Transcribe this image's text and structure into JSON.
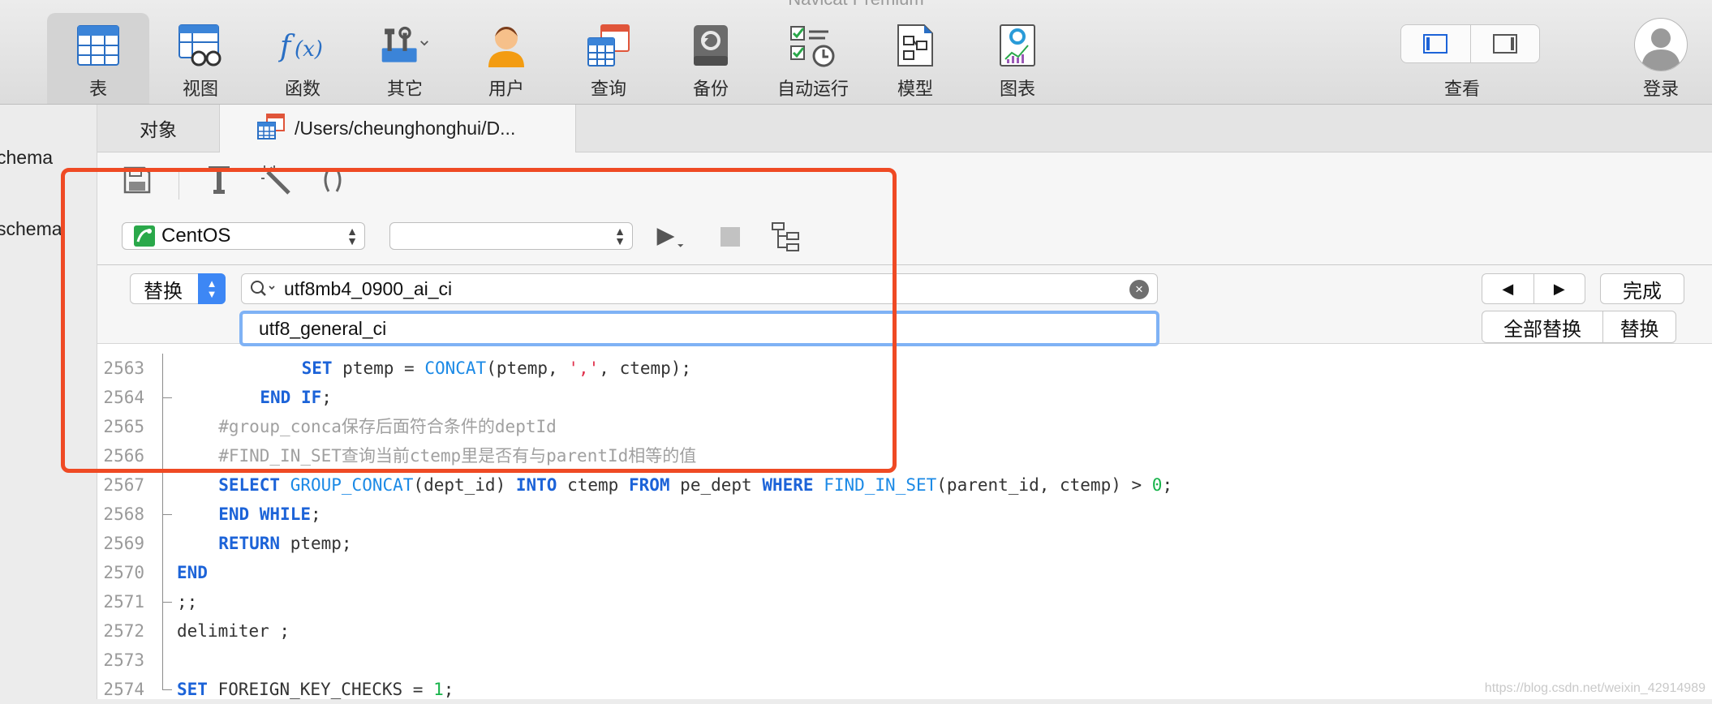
{
  "window_title": "Navicat Premium",
  "toolbar": {
    "items": [
      {
        "label": "表",
        "icon": "table-icon"
      },
      {
        "label": "视图",
        "icon": "view-icon"
      },
      {
        "label": "函数",
        "icon": "function-icon"
      },
      {
        "label": "其它",
        "icon": "tools-icon"
      },
      {
        "label": "用户",
        "icon": "user-icon"
      },
      {
        "label": "查询",
        "icon": "query-icon"
      },
      {
        "label": "备份",
        "icon": "backup-icon"
      },
      {
        "label": "自动运行",
        "icon": "automation-icon"
      },
      {
        "label": "模型",
        "icon": "model-icon"
      },
      {
        "label": "图表",
        "icon": "chart-icon"
      }
    ],
    "view_label": "查看",
    "login_label": "登录"
  },
  "sidebar": {
    "items": [
      "chema",
      "schema"
    ]
  },
  "tabs": {
    "objects": "对象",
    "file": "/Users/cheunghonghui/D..."
  },
  "query": {
    "connection": "CentOS",
    "database": ""
  },
  "find": {
    "mode": "替换",
    "search_value": "utf8mb4_0900_ai_ci",
    "replace_value": "utf8_general_ci",
    "prev_glyph": "◀",
    "next_glyph": "▶",
    "done": "完成",
    "replace_all": "全部替换",
    "replace": "替换"
  },
  "code": {
    "lines": [
      {
        "num": "2563",
        "indent": 6,
        "tokens": [
          [
            "kw",
            "SET"
          ],
          [
            "t",
            " ptemp = "
          ],
          [
            "fn",
            "CONCAT"
          ],
          [
            "t",
            "(ptemp, "
          ],
          [
            "str",
            "','"
          ],
          [
            "t",
            ", ctemp);"
          ]
        ]
      },
      {
        "num": "2564",
        "indent": 4,
        "fold": "end",
        "tokens": [
          [
            "kw",
            "END IF"
          ],
          [
            "t",
            ";"
          ]
        ]
      },
      {
        "num": "2565",
        "indent": 2,
        "tokens": [
          [
            "cm",
            "#group_conca保存后面符合条件的deptId"
          ]
        ]
      },
      {
        "num": "2566",
        "indent": 2,
        "tokens": [
          [
            "cm",
            "#FIND_IN_SET查询当前ctemp里是否有与parentId相等的值"
          ]
        ]
      },
      {
        "num": "2567",
        "indent": 2,
        "tokens": [
          [
            "kw",
            "SELECT"
          ],
          [
            "t",
            " "
          ],
          [
            "fn",
            "GROUP_CONCAT"
          ],
          [
            "t",
            "(dept_id) "
          ],
          [
            "kw",
            "INTO"
          ],
          [
            "t",
            " ctemp "
          ],
          [
            "kw",
            "FROM"
          ],
          [
            "t",
            " pe_dept "
          ],
          [
            "kw",
            "WHERE"
          ],
          [
            "t",
            " "
          ],
          [
            "fn",
            "FIND_IN_SET"
          ],
          [
            "t",
            "(parent_id, ctemp) > "
          ],
          [
            "num",
            "0"
          ],
          [
            "t",
            ";"
          ]
        ]
      },
      {
        "num": "2568",
        "indent": 2,
        "fold": "end",
        "tokens": [
          [
            "kw",
            "END WHILE"
          ],
          [
            "t",
            ";"
          ]
        ]
      },
      {
        "num": "2569",
        "indent": 2,
        "tokens": [
          [
            "kw",
            "RETURN"
          ],
          [
            "t",
            " ptemp;"
          ]
        ]
      },
      {
        "num": "2570",
        "indent": 0,
        "tokens": [
          [
            "kw",
            "END"
          ]
        ]
      },
      {
        "num": "2571",
        "indent": 0,
        "fold": "end",
        "tokens": [
          [
            "t",
            ";;"
          ]
        ]
      },
      {
        "num": "2572",
        "indent": 0,
        "tokens": [
          [
            "t",
            "delimiter ;"
          ]
        ]
      },
      {
        "num": "2573",
        "indent": 0,
        "tokens": []
      },
      {
        "num": "2574",
        "indent": 0,
        "fold": "last",
        "tokens": [
          [
            "kw",
            "SET"
          ],
          [
            "t",
            " FOREIGN_KEY_CHECKS = "
          ],
          [
            "num",
            "1"
          ],
          [
            "t",
            ";"
          ]
        ]
      }
    ]
  },
  "watermark": "https://blog.csdn.net/weixin_42914989",
  "colors": {
    "highlight_border": "#ef4a24",
    "keyword": "#1c63d8",
    "function": "#1c8ae6",
    "string": "#e0324d",
    "number": "#17b34a",
    "comment": "#a0a0a0",
    "accent": "#3d87f5"
  }
}
